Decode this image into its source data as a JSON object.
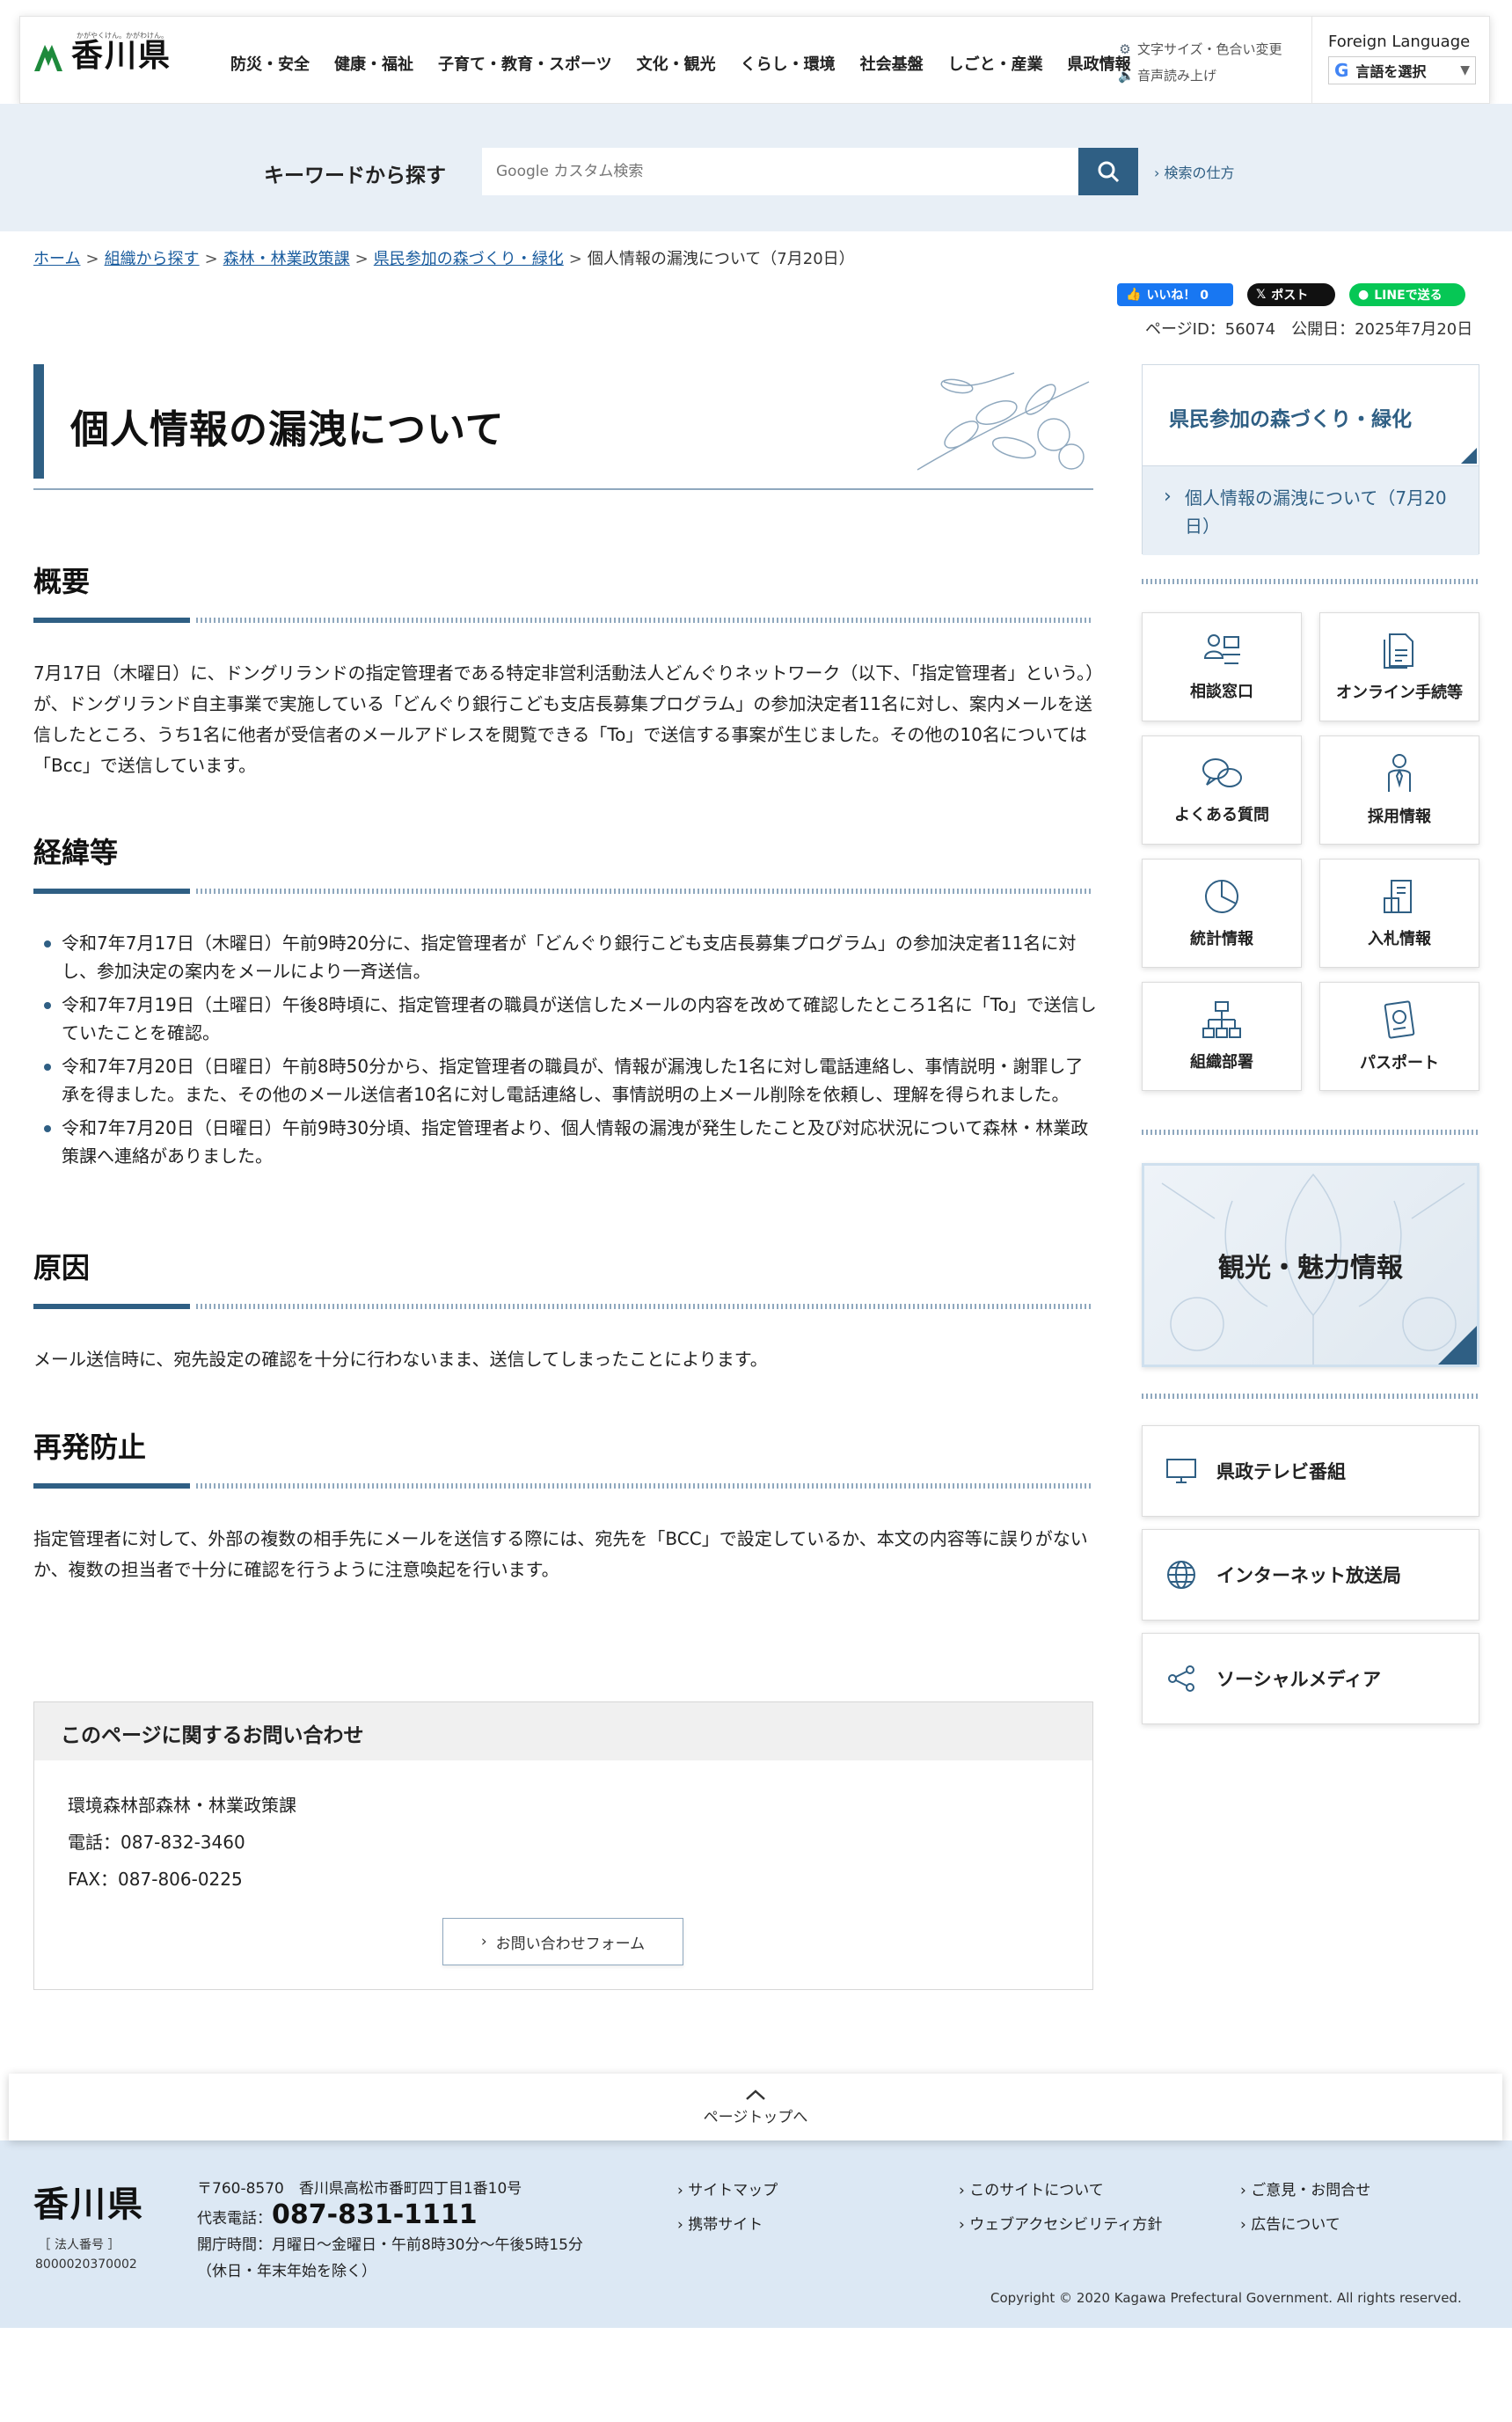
{
  "header": {
    "logo_text": "香川県",
    "logo_sub": "かがやくけん。かがわけん。",
    "nav": [
      "防災・安全",
      "健康・福祉",
      "子育て・教育・スポーツ",
      "文化・観光",
      "くらし・環境",
      "社会基盤",
      "しごと・産業",
      "県政情報"
    ],
    "util_font": "文字サイズ・色合い変更",
    "util_voice": "音声読み上げ",
    "lang_title": "Foreign Language",
    "lang_select": "言語を選択"
  },
  "search": {
    "label": "キーワードから探す",
    "placeholder": "Google カスタム検索",
    "help": "検索の仕方"
  },
  "breadcrumb": {
    "items": [
      "ホーム",
      "組織から探す",
      "森林・林業政策課",
      "県民参加の森づくり・緑化"
    ],
    "current": "個人情報の漏洩について（7月20日）"
  },
  "social": {
    "fb": "いいね！ 0",
    "x": "ポスト",
    "line": "LINEで送る"
  },
  "page_meta": "ページID：56074　公開日：2025年7月20日",
  "main": {
    "title": "個人情報の漏洩について",
    "sections": {
      "overview": {
        "heading": "概要",
        "body": "7月17日（木曜日）に、ドングリランドの指定管理者である特定非営利活動法人どんぐりネットワーク（以下、「指定管理者」という。）が、ドングリランド自主事業で実施している「どんぐり銀行こども支店長募集プログラム」の参加決定者11名に対し、案内メールを送信したところ、うち1名に他者が受信者のメールアドレスを閲覧できる「To」で送信する事案が生じました。その他の10名については「Bcc」で送信しています。"
      },
      "history": {
        "heading": "経緯等",
        "items": [
          "令和7年7月17日（木曜日）午前9時20分に、指定管理者が「どんぐり銀行こども支店長募集プログラム」の参加決定者11名に対し、参加決定の案内をメールにより一斉送信。",
          "令和7年7月19日（土曜日）午後8時頃に、指定管理者の職員が送信したメールの内容を改めて確認したところ1名に「To」で送信していたことを確認。",
          "令和7年7月20日（日曜日）午前8時50分から、指定管理者の職員が、情報が漏洩した1名に対し電話連絡し、事情説明・謝罪し了承を得ました。また、その他のメール送信者10名に対し電話連絡し、事情説明の上メール削除を依頼し、理解を得られました。",
          "令和7年7月20日（日曜日）午前9時30分頃、指定管理者より、個人情報の漏洩が発生したこと及び対応状況について森林・林業政策課へ連絡がありました。"
        ]
      },
      "cause": {
        "heading": "原因",
        "body": "メール送信時に、宛先設定の確認を十分に行わないまま、送信してしまったことによります。"
      },
      "prevention": {
        "heading": "再発防止",
        "body": "指定管理者に対して、外部の複数の相手先にメールを送信する際には、宛先を「BCC」で設定しているか、本文の内容等に誤りがないか、複数の担当者で十分に確認を行うように注意喚起を行います。"
      }
    },
    "contact": {
      "heading": "このページに関するお問い合わせ",
      "dept": "環境森林部森林・林業政策課",
      "tel": "電話：087-832-3460",
      "fax": "FAX：087-806-0225",
      "button": "お問い合わせフォーム"
    }
  },
  "sidebar": {
    "menu_head": "県民参加の森づくり・緑化",
    "menu_item": "個人情報の漏洩について（7月20日）",
    "tiles": [
      "相談窓口",
      "オンライン手続等",
      "よくある質問",
      "採用情報",
      "統計情報",
      "入札情報",
      "組織部署",
      "パスポート"
    ],
    "tourism": "観光・魅力情報",
    "links": [
      "県政テレビ番組",
      "インターネット放送局",
      "ソーシャルメディア"
    ]
  },
  "pagetop": "ページトップへ",
  "footer": {
    "logo": "香川県",
    "corp_label": "［ 法人番号 ］",
    "corp_number": "8000020370002",
    "address": "〒760-8570　香川県高松市番町四丁目1番10号",
    "tel_label": "代表電話：",
    "tel": "087-831-1111",
    "hours": "開庁時間：月曜日～金曜日・午前8時30分～午後5時15分",
    "hours_note": "（休日・年末年始を除く）",
    "links": [
      "サイトマップ",
      "このサイトについて",
      "ご意見・お問合せ",
      "携帯サイト",
      "ウェブアクセシビリティ方針",
      "広告について"
    ],
    "copyright": "Copyright © 2020 Kagawa Prefectural Government. All rights reserved."
  },
  "colors": {
    "accent": "#2f5f84",
    "band": "#e8eff6",
    "footer": "#dce8f4"
  }
}
